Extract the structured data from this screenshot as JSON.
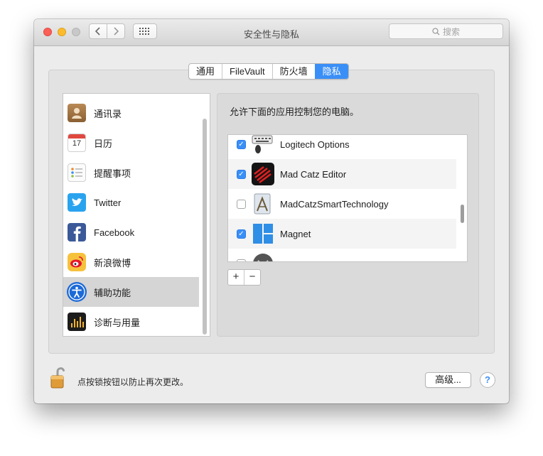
{
  "window": {
    "title": "安全性与隐私"
  },
  "toolbar": {
    "search_placeholder": "搜索"
  },
  "tabs": [
    {
      "label": "通用",
      "active": false
    },
    {
      "label": "FileVault",
      "active": false
    },
    {
      "label": "防火墙",
      "active": false
    },
    {
      "label": "隐私",
      "active": true
    }
  ],
  "sidebar": {
    "items": [
      {
        "label": "通讯录",
        "icon": "contacts-icon",
        "selected": false
      },
      {
        "label": "日历",
        "icon": "calendar-icon",
        "selected": false,
        "day": "17"
      },
      {
        "label": "提醒事项",
        "icon": "reminders-icon",
        "selected": false
      },
      {
        "label": "Twitter",
        "icon": "twitter-icon",
        "selected": false
      },
      {
        "label": "Facebook",
        "icon": "facebook-icon",
        "selected": false
      },
      {
        "label": "新浪微博",
        "icon": "weibo-icon",
        "selected": false
      },
      {
        "label": "辅助功能",
        "icon": "accessibility-icon",
        "selected": true
      },
      {
        "label": "诊断与用量",
        "icon": "diagnostics-icon",
        "selected": false
      }
    ]
  },
  "main": {
    "description": "允许下面的应用控制您的电脑。",
    "apps": [
      {
        "label": "Logitech Options",
        "checked": true,
        "icon": "logitech-options-icon"
      },
      {
        "label": "Mad Catz Editor",
        "checked": true,
        "icon": "mad-catz-editor-icon"
      },
      {
        "label": "MadCatzSmartTechnology",
        "checked": false,
        "icon": "madcatz-smart-technology-icon"
      },
      {
        "label": "Magnet",
        "checked": true,
        "icon": "magnet-icon"
      },
      {
        "label": "",
        "checked": false,
        "icon": "partial-app-icon"
      }
    ],
    "add_label": "+",
    "remove_label": "−"
  },
  "footer": {
    "lock_text": "点按锁按钮以防止再次更改。",
    "advanced_label": "高级...",
    "help_label": "?"
  },
  "colors": {
    "accent": "#3a8ff7",
    "close": "#fc5f57",
    "minimize": "#fdbc2e",
    "zoom_disabled": "#c8c8c8"
  }
}
